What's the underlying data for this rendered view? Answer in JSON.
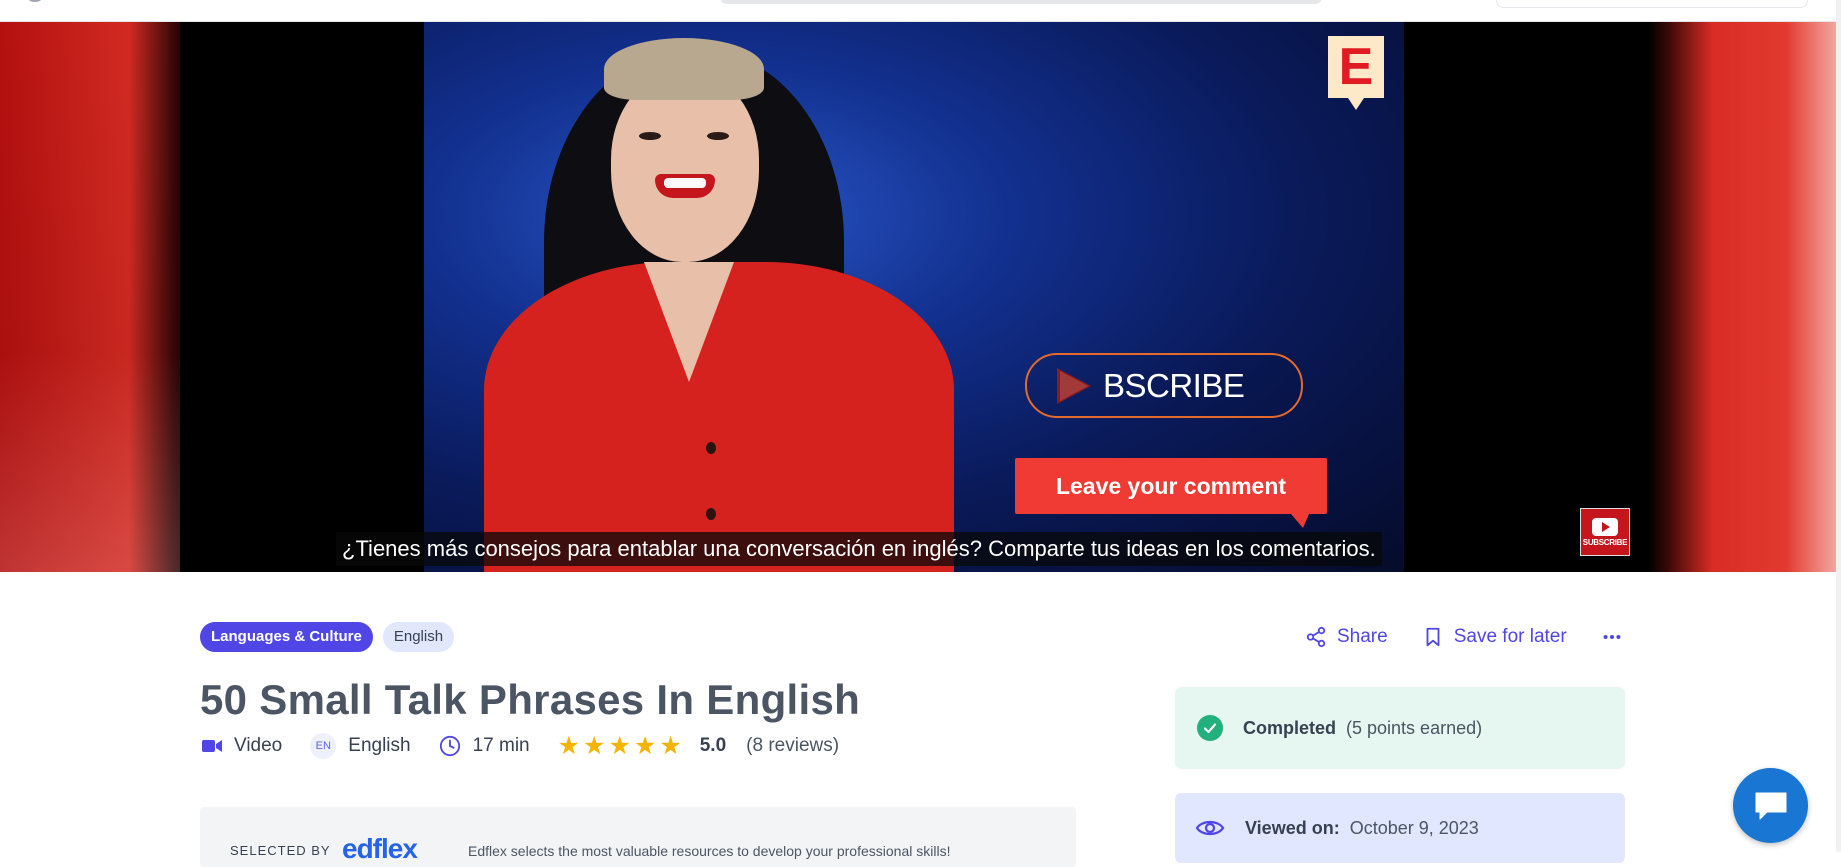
{
  "video": {
    "logo_letter": "E",
    "subscribe_text": "BSCRIBE",
    "comment_prompt": "Leave your comment",
    "caption": "¿Tienes más consejos para entablar una conversación en inglés? Comparte tus ideas en los comentarios.",
    "yt_subscribe_label": "SUBSCRIBE"
  },
  "tags": [
    "Languages & Culture",
    "English"
  ],
  "actions": {
    "share": "Share",
    "save": "Save for later"
  },
  "title": "50 Small Talk Phrases In English",
  "meta": {
    "type": "Video",
    "language_code": "EN",
    "language": "English",
    "duration": "17 min",
    "rating_value": 5,
    "rating": "5.0",
    "reviews": "(8 reviews)"
  },
  "selected_by": {
    "label": "SELECTED BY",
    "brand": "edflex",
    "description": "Edflex selects the most valuable resources to develop your professional skills!"
  },
  "status": {
    "completed_label": "Completed",
    "completed_sub": "(5 points earned)",
    "viewed_label": "Viewed on:",
    "viewed_date": "October 9, 2023"
  },
  "colors": {
    "accent": "#4f46e5",
    "success": "#22b07d",
    "star": "#f5b400",
    "chat": "#1976d2"
  }
}
